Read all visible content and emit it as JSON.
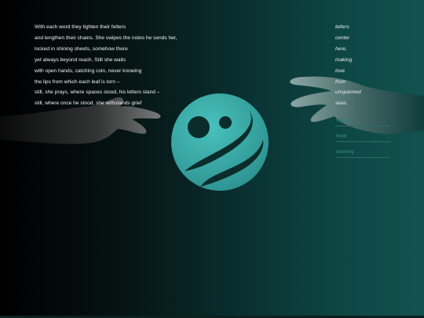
{
  "poem": {
    "lines": [
      "With each word they tighten their fetters",
      "and lengthen their chains. She swipes the notes he sends her,",
      "locked in shining sheets, somehow there",
      "yet always beyond reach. Still she waits",
      "with open hands, catching coin, never knowing",
      "the lips from which each leaf is torn –",
      "still, she prays, where spaces stood, his letters stand –",
      "still, where once he stood, she withstands grief"
    ]
  },
  "side_words": [
    "letters",
    "center",
    "here,",
    "making",
    "love",
    "from",
    "unspanned",
    "seas."
  ],
  "actions": {
    "release": "release",
    "hold": "hold",
    "destroy": "destroy"
  },
  "colors": {
    "background_dark": "#000000",
    "background_teal": "#12524e",
    "logo_teal": "#33a9a6",
    "action_text": "#2f7f78"
  },
  "icons": {
    "logo": "teal-circle-swirl-logo",
    "left_hand": "reaching-hand-left",
    "right_hand": "reaching-hand-right"
  }
}
